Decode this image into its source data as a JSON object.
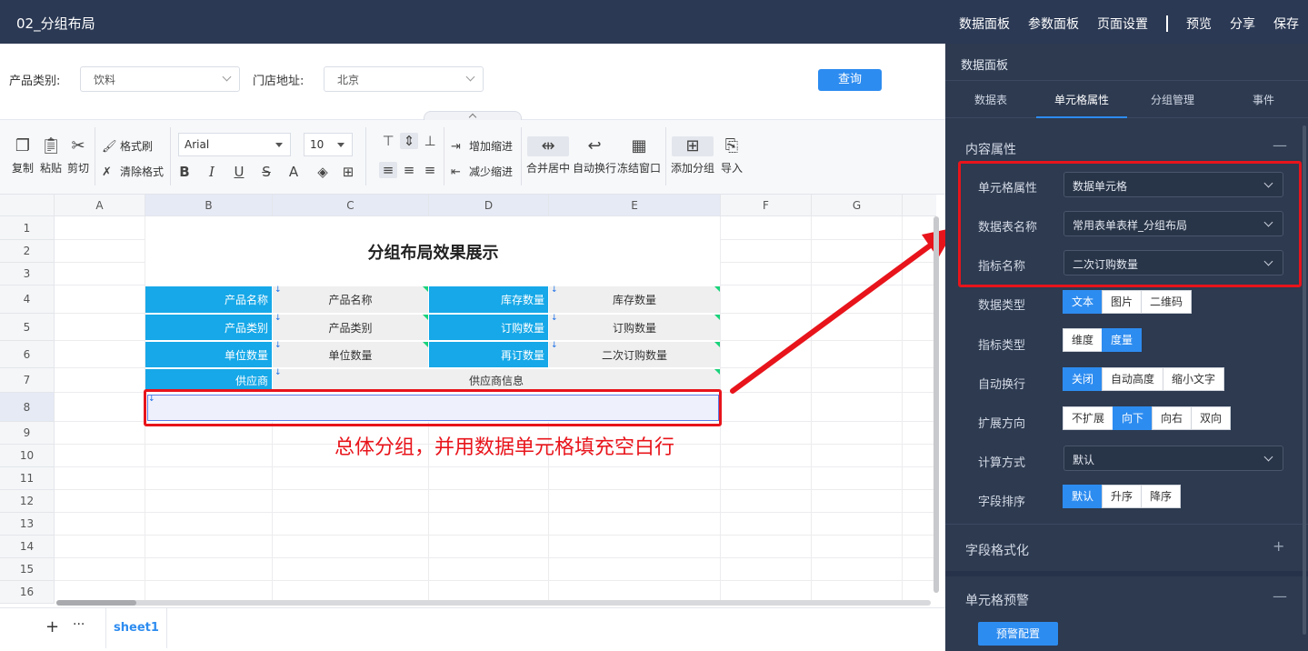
{
  "topbar": {
    "title": "02_分组布局",
    "menu": [
      "数据面板",
      "参数面板",
      "页面设置",
      "预览",
      "分享",
      "保存"
    ]
  },
  "filters": {
    "category_label": "产品类别:",
    "category_value": "饮料",
    "store_label": "门店地址:",
    "store_value": "北京",
    "query_button": "查询"
  },
  "toolbar": {
    "copy": "复制",
    "paste": "粘贴",
    "cut": "剪切",
    "format_painter": "格式刷",
    "clear_format": "清除格式",
    "font": "Arial",
    "font_size": "10",
    "indent_increase": "增加缩进",
    "indent_decrease": "减少缩进",
    "merge_center": "合并居中",
    "auto_wrap": "自动换行",
    "freeze": "冻结窗口",
    "add_group": "添加分组",
    "import": "导入"
  },
  "sheet": {
    "columns": [
      "A",
      "B",
      "C",
      "D",
      "E",
      "F",
      "G"
    ],
    "rows": [
      "1",
      "2",
      "3",
      "4",
      "5",
      "6",
      "7",
      "8",
      "9",
      "10",
      "11",
      "12",
      "13",
      "14",
      "15",
      "16"
    ],
    "title": "分组布局效果展示",
    "cells": {
      "r4b": "产品名称",
      "r4c": "产品名称",
      "r4d": "库存数量",
      "r4e": "库存数量",
      "r5b": "产品类别",
      "r5c": "产品类别",
      "r5d": "订购数量",
      "r5e": "订购数量",
      "r6b": "单位数量",
      "r6c": "单位数量",
      "r6d": "再订数量",
      "r6e": "二次订购数量",
      "r7b": "供应商",
      "r7cde": "供应商信息"
    },
    "annotation": "总体分组，并用数据单元格填充空白行",
    "tab": "sheet1"
  },
  "panel": {
    "title": "数据面板",
    "tabs": [
      "数据表",
      "单元格属性",
      "分组管理",
      "事件"
    ],
    "section_content": "内容属性",
    "cell_attr_label": "单元格属性",
    "cell_attr_value": "数据单元格",
    "table_name_label": "数据表名称",
    "table_name_value": "常用表单表样_分组布局",
    "metric_label": "指标名称",
    "metric_value": "二次订购数量",
    "data_type_label": "数据类型",
    "data_type_opts": [
      "文本",
      "图片",
      "二维码"
    ],
    "metric_type_label": "指标类型",
    "metric_type_opts": [
      "维度",
      "度量"
    ],
    "wrap_label": "自动换行",
    "wrap_opts": [
      "关闭",
      "自动高度",
      "缩小文字"
    ],
    "expand_label": "扩展方向",
    "expand_opts": [
      "不扩展",
      "向下",
      "向右",
      "双向"
    ],
    "calc_label": "计算方式",
    "calc_value": "默认",
    "sort_label": "字段排序",
    "sort_opts": [
      "默认",
      "升序",
      "降序"
    ],
    "section_format": "字段格式化",
    "section_alert": "单元格预警",
    "alert_button": "预警配置"
  },
  "colors": {
    "accent": "#2d8cf0",
    "panel_bg": "#2d3a50",
    "topbar_bg": "#2b3954",
    "cell_blue": "#16a8e8",
    "annotation_red": "#e8141b"
  }
}
